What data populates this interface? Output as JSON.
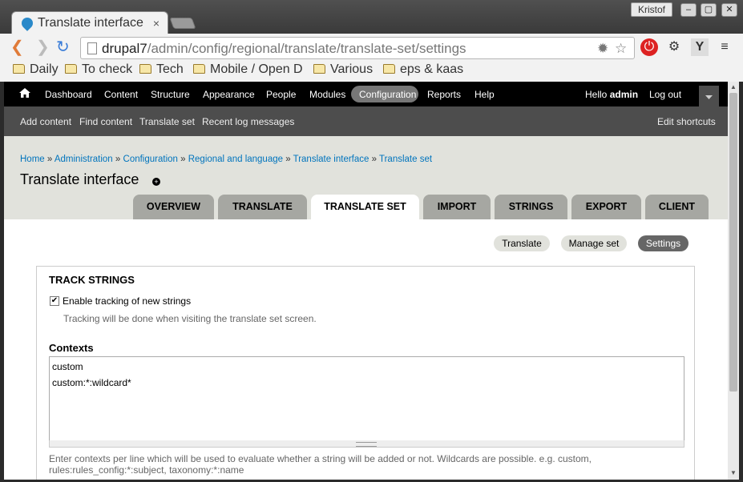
{
  "browser": {
    "tab_title": "Translate interface",
    "tab_close": "×",
    "user": "Kristof",
    "window_buttons": {
      "minimize": "–",
      "maximize": "▢",
      "close": "✕"
    },
    "url_host": "drupal7",
    "url_path": "/admin/config/regional/translate/translate-set/settings",
    "bookmarks": [
      "Daily",
      "To check",
      "Tech",
      "Mobile / Open D",
      "Various",
      "eps & kaas"
    ]
  },
  "admin_menu": {
    "items": [
      "Dashboard",
      "Content",
      "Structure",
      "Appearance",
      "People",
      "Modules",
      "Configuration",
      "Reports",
      "Help"
    ],
    "hello": "Hello",
    "username": "admin",
    "logout": "Log out"
  },
  "shortcuts": {
    "items": [
      "Add content",
      "Find content",
      "Translate set",
      "Recent log messages"
    ],
    "edit": "Edit shortcuts"
  },
  "breadcrumb": [
    "Home",
    "Administration",
    "Configuration",
    "Regional and language",
    "Translate interface",
    "Translate set"
  ],
  "breadcrumb_sep": " » ",
  "page_title": "Translate interface",
  "primary_tabs": [
    "Overview",
    "Translate",
    "Translate set",
    "Import",
    "Strings",
    "Export",
    "Client"
  ],
  "secondary_tabs": [
    "Translate",
    "Manage set",
    "Settings"
  ],
  "form": {
    "fieldset_title": "Track strings",
    "checkbox_label": "Enable tracking of new strings",
    "checkbox_checked": true,
    "checkbox_desc": "Tracking will be done when visiting the translate set screen.",
    "contexts_label": "Contexts",
    "contexts_value": [
      "custom",
      "custom:*:wildcard*"
    ],
    "contexts_desc_1": "Enter contexts per line which will be used to evaluate whether a string will be added or not. Wildcards are possible. e.g. custom,",
    "contexts_desc_2": "rules:rules_config:*:subject, taxonomy:*:name"
  },
  "colors": {
    "admin_bar": "#000000",
    "shortcut_bar": "#4d4d4d",
    "header_bg": "#e1e2dc",
    "link": "#0074bd",
    "active_pill": "#666666"
  }
}
